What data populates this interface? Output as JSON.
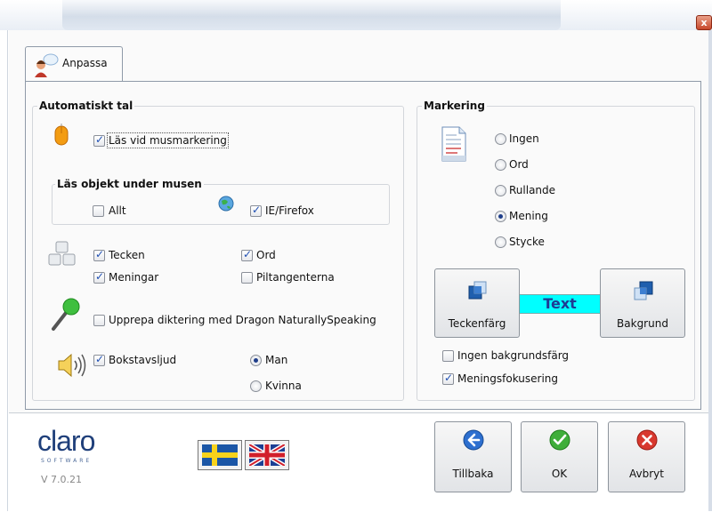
{
  "window": {
    "close_glyph": "x"
  },
  "tab": {
    "label": "Anpassa"
  },
  "automatiskt_tal": {
    "title": "Automatiskt tal",
    "las_vid_musmarkering": {
      "label": "Läs vid musmarkering",
      "checked": true
    },
    "las_objekt": {
      "title": "Läs objekt under musen",
      "allt": {
        "label": "Allt",
        "checked": false
      },
      "ie_firefox": {
        "label": "IE/Firefox",
        "checked": true
      }
    },
    "tecken": {
      "label": "Tecken",
      "checked": true
    },
    "ord": {
      "label": "Ord",
      "checked": true
    },
    "meningar": {
      "label": "Meningar",
      "checked": true
    },
    "piltangenterna": {
      "label": "Piltangenterna",
      "checked": false
    },
    "upprepa": {
      "label": "Upprepa diktering med Dragon NaturallySpeaking",
      "checked": false
    },
    "bokstavsljud": {
      "label": "Bokstavsljud",
      "checked": true
    },
    "man": {
      "label": "Man",
      "selected": true
    },
    "kvinna": {
      "label": "Kvinna",
      "selected": false
    }
  },
  "markering": {
    "title": "Markering",
    "options": [
      {
        "label": "Ingen",
        "selected": false
      },
      {
        "label": "Ord",
        "selected": false
      },
      {
        "label": "Rullande",
        "selected": false
      },
      {
        "label": "Mening",
        "selected": true
      },
      {
        "label": "Stycke",
        "selected": false
      }
    ],
    "teckenfarg_label": "Teckenfärg",
    "bakgrund_label": "Bakgrund",
    "preview_text": "Text",
    "preview_bg_color": "#00ffff",
    "preview_text_color": "#1f3a93",
    "ingen_bakgrundsfarg": {
      "label": "Ingen bakgrundsfärg",
      "checked": false
    },
    "meningsfokusering": {
      "label": "Meningsfokusering",
      "checked": true
    }
  },
  "footer": {
    "logo_text": "claro",
    "logo_sub": "SOFTWARE",
    "version": "V 7.0.21",
    "tillbaka_label": "Tillbaka",
    "ok_label": "OK",
    "avbryt_label": "Avbryt"
  }
}
